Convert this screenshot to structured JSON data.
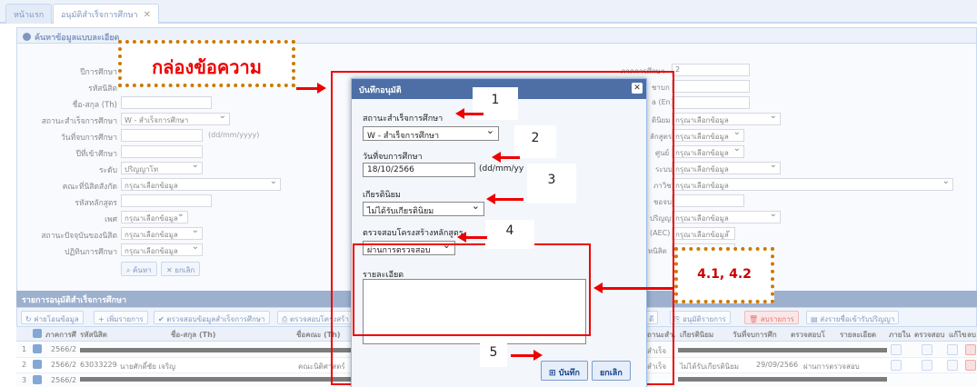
{
  "tabs": [
    {
      "label": "หน้าแรก"
    },
    {
      "label": "อนุมัติสำเร็จการศึกษา"
    }
  ],
  "search_panel": {
    "title": "ค้นหาข้อมูลแบบละเอียด",
    "fields": {
      "academic_year_label": "ปีการศึกษา",
      "academic_year_value": "2566",
      "student_id_label": "รหัสนิสิต",
      "name_th_label": "ชื่อ-สกุล (Th)",
      "grad_status_label": "สถานะสำเร็จการศึกษา",
      "grad_status_value": "W - สำเร็จการศึกษา",
      "grad_date_label": "วันที่จบการศึกษา",
      "date_hint": "(dd/mm/yyyy)",
      "entry_year_label": "ปีที่เข้าศึกษา",
      "level_label": "ระดับ",
      "level_value": "ปริญญาโท",
      "faculty_label": "คณะที่นิสิตสังกัด",
      "faculty_value": "กรุณาเลือกข้อมูล",
      "curriculum_code_label": "รหัสหลักสูตร",
      "gender_label": "เพศ",
      "gender_value": "กรุณาเลือกข้อมูล",
      "current_status_label": "สถานะปัจจุบันของนิสิต",
      "current_status_value": "กรุณาเลือกข้อมูล",
      "calendar_label": "ปฏิทินการศึกษา",
      "calendar_value": "กรุณาเลือกข้อมูล"
    },
    "right_fields": {
      "semester_label": "ภาคการศึกษา",
      "semester_value": "2",
      "r2": "ชาบก",
      "r3": "a (En)",
      "r4": "ดินิยม",
      "r5": "ลักสูตร",
      "r6": "ศูนย์",
      "r7": "ระบบ",
      "r8": "ภาวิชา",
      "r9": "ชอจบ",
      "r10": "ปริญญา",
      "r11": "(AEC)",
      "r12": "หนิสิต",
      "placeholder": "กรุณาเลือกข้อมูล"
    },
    "search_button": "ค้นหา",
    "cancel_button": "ยกเลิก"
  },
  "list_panel": {
    "title": "รายการอนุมัติสำเร็จการศึกษา",
    "toolbar": [
      "ค่ายโอนข้อมูล",
      "เพิ่มรายการ",
      "ตรวจสอบข้อมูลสำเร็จการศึกษา",
      "ตรวจสอบโครงสร้า",
      "ดี",
      "อนุมัติรายการ",
      "ลบรายการ",
      "ส่งรายชื่อเข้ารับปริญญา"
    ],
    "columns_left": [
      "ภาคการศึ",
      "รหัสนิสิต",
      "ชื่อ-สกุล (Th)",
      "ชื่อคณะ (Th)"
    ],
    "columns_right": [
      "ถานะสำเ",
      "เกียรตินิยม",
      "วันที่จบการศึก",
      "ตรวจสอบโ",
      "รายละเอียด",
      "ภายใน",
      "ตรวจสอบ",
      "แก้ไข",
      "ลบ"
    ],
    "rows": [
      {
        "num": "1",
        "term": "2566/2",
        "status": "สำเร็จ"
      },
      {
        "num": "2",
        "term": "2566/2",
        "student_id": "63033229",
        "name": "นายศักดิ์ชัย เจริญ",
        "faculty": "คณะนิติศาสตร์",
        "status": "สำเร็จ",
        "honor": "ไม่ได้รับเกียรตินิยม",
        "date": "29/09/2566",
        "check": "ผ่านการตรวจสอบ"
      },
      {
        "num": "3",
        "term": "2566/2"
      }
    ]
  },
  "dialog": {
    "title": "บันทึกอนุมัติ",
    "grad_status_label": "สถานะสำเร็จการศึกษา",
    "grad_status_value": "W - สำเร็จการศึกษา",
    "grad_date_label": "วันที่จบการศึกษา",
    "grad_date_value": "18/10/2566",
    "date_hint": "(dd/mm/yy",
    "honor_label": "เกียรตินิยม",
    "honor_value": "ไม่ได้รับเกียรตินิยม",
    "curriculum_check_label": "ตรวจสอบโครงสร้างหลักสูตร",
    "curriculum_check_value": "ผ่านการตรวจสอบ",
    "detail_label": "รายละเอียด",
    "save_button": "บันทึก",
    "cancel_button": "ยกเลิก"
  },
  "annotations": {
    "textbox_callout": "กล่องข้อความ",
    "n1": "1",
    "n2": "2",
    "n3": "3",
    "n4": "4",
    "n5": "5",
    "detail_callout": "4.1, 4.2"
  }
}
